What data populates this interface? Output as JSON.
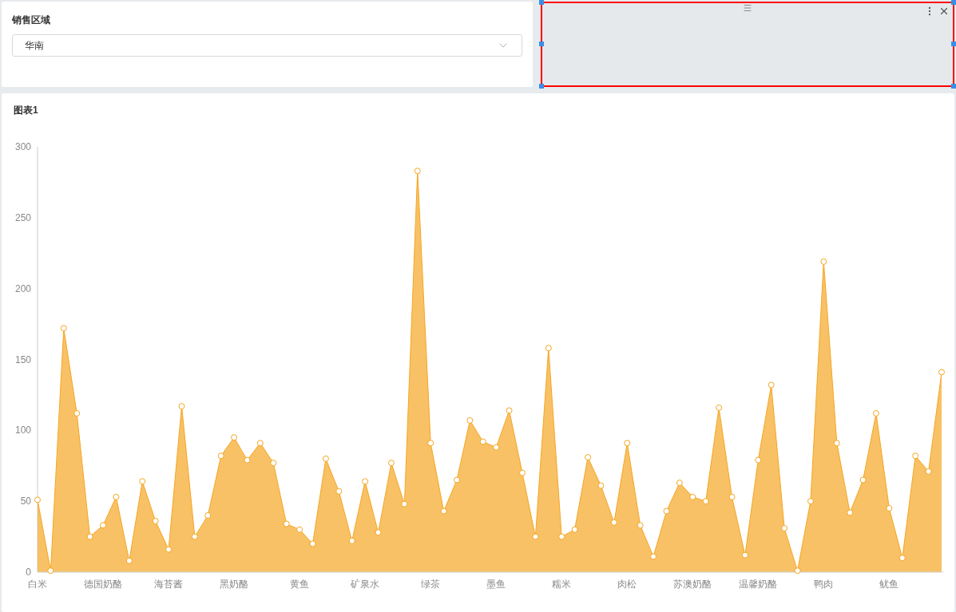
{
  "filter": {
    "label": "销售区域",
    "value": "华南"
  },
  "chart": {
    "title": "图表1",
    "chart_data": {
      "type": "area",
      "categories": [
        "白米",
        null,
        null,
        null,
        null,
        "德国奶酪",
        null,
        null,
        null,
        null,
        "海苔酱",
        null,
        null,
        null,
        null,
        "黑奶酪",
        null,
        null,
        null,
        null,
        "黄鱼",
        null,
        null,
        null,
        null,
        "矿泉水",
        null,
        null,
        null,
        null,
        "绿茶",
        null,
        null,
        null,
        null,
        "墨鱼",
        null,
        null,
        null,
        null,
        "糯米",
        null,
        null,
        null,
        null,
        "肉松",
        null,
        null,
        null,
        null,
        "苏澳奶酪",
        null,
        null,
        null,
        null,
        "温馨奶酪",
        null,
        null,
        null,
        null,
        "鸭肉",
        null,
        null,
        null,
        null,
        "鱿鱼",
        null,
        null,
        null,
        null
      ],
      "series": [
        {
          "color": "#f5a623",
          "values": [
            51,
            1,
            172,
            112,
            25,
            33,
            53,
            8,
            64,
            36,
            16,
            117,
            25,
            40,
            82,
            95,
            79,
            91,
            77,
            34,
            30,
            20,
            80,
            57,
            22,
            64,
            28,
            77,
            48,
            283,
            91,
            43,
            65,
            107,
            92,
            88,
            114,
            70,
            25,
            158,
            25,
            30,
            81,
            61,
            35,
            91,
            33,
            11,
            43,
            63,
            53,
            50,
            116,
            53,
            12,
            79,
            132,
            31,
            1,
            50,
            219,
            91,
            42,
            65,
            112,
            45,
            10,
            82,
            71,
            141
          ]
        }
      ],
      "ylim": [
        0,
        300
      ],
      "yticks": [
        0,
        50,
        100,
        150,
        200,
        250,
        300
      ]
    }
  }
}
